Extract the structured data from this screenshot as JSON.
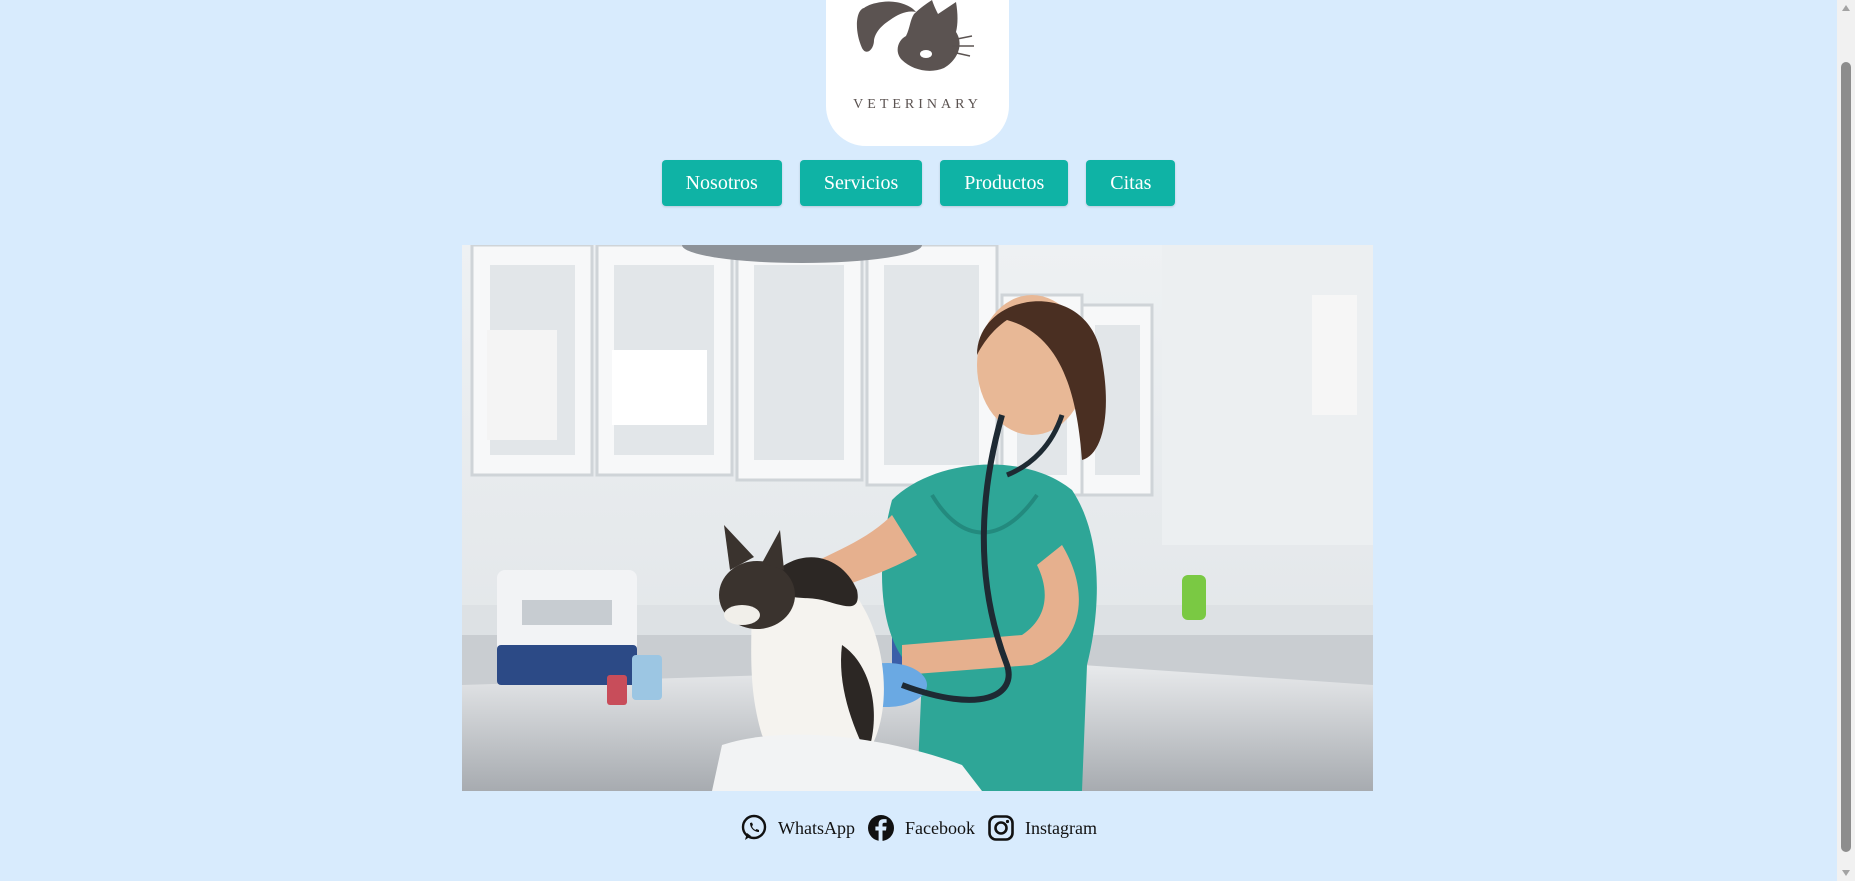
{
  "logo": {
    "text": "VETERINARY",
    "icon": "dog-cat-logo-icon"
  },
  "nav": {
    "items": [
      {
        "label": "Nosotros"
      },
      {
        "label": "Servicios"
      },
      {
        "label": "Productos"
      },
      {
        "label": "Citas"
      }
    ]
  },
  "hero": {
    "image": "veterinarian-examining-cat-photo"
  },
  "social": {
    "links": [
      {
        "label": "WhatsApp",
        "icon": "whatsapp-icon"
      },
      {
        "label": "Facebook",
        "icon": "facebook-icon"
      },
      {
        "label": "Instagram",
        "icon": "instagram-icon"
      }
    ]
  },
  "colors": {
    "background": "#d8ebfd",
    "accent": "#0fb3a5",
    "logo_brown": "#5b5351"
  }
}
